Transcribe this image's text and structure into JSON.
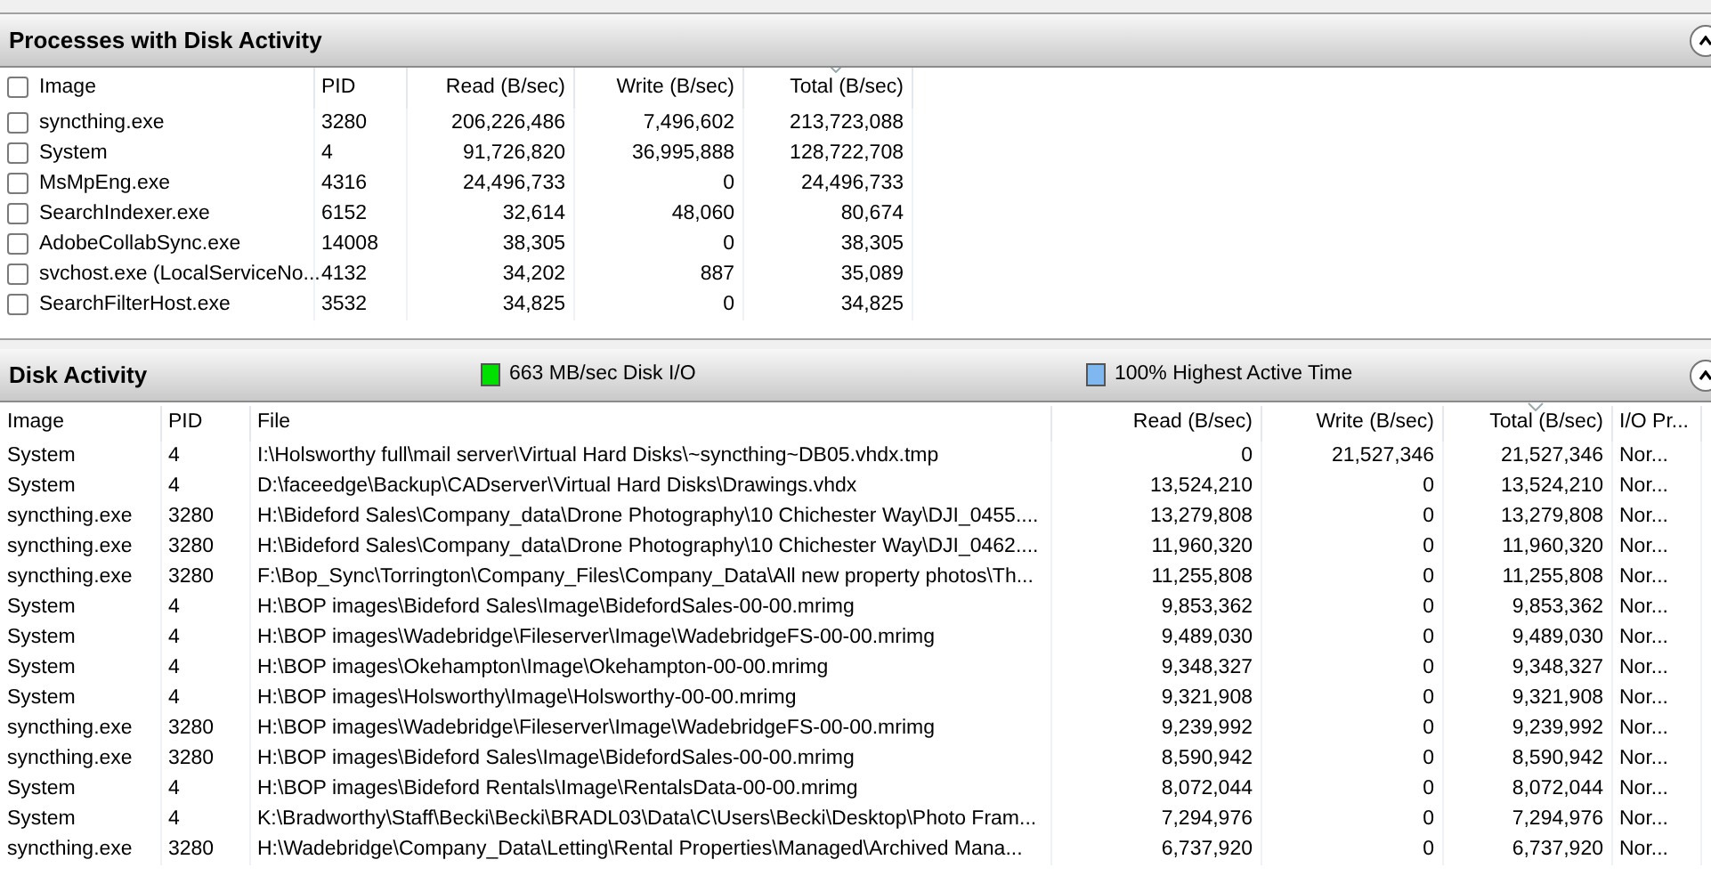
{
  "processes_panel": {
    "title": "Processes with Disk Activity",
    "expanded": true,
    "select_all": {
      "checked": false
    },
    "columns": [
      {
        "label": "Image",
        "sorted": false
      },
      {
        "label": "PID",
        "sorted": false
      },
      {
        "label": "Read (B/sec)",
        "sorted": false
      },
      {
        "label": "Write (B/sec)",
        "sorted": false
      },
      {
        "label": "Total (B/sec)",
        "sorted": true
      }
    ],
    "rows": [
      {
        "checked": false,
        "cells": [
          "syncthing.exe",
          "3280",
          "206,226,486",
          "7,496,602",
          "213,723,088"
        ]
      },
      {
        "checked": false,
        "cells": [
          "System",
          "4",
          "91,726,820",
          "36,995,888",
          "128,722,708"
        ]
      },
      {
        "checked": false,
        "cells": [
          "MsMpEng.exe",
          "4316",
          "24,496,733",
          "0",
          "24,496,733"
        ]
      },
      {
        "checked": false,
        "cells": [
          "SearchIndexer.exe",
          "6152",
          "32,614",
          "48,060",
          "80,674"
        ]
      },
      {
        "checked": false,
        "cells": [
          "AdobeCollabSync.exe",
          "14008",
          "38,305",
          "0",
          "38,305"
        ]
      },
      {
        "checked": false,
        "cells": [
          "svchost.exe (LocalServiceNo...",
          "4132",
          "34,202",
          "887",
          "35,089"
        ]
      },
      {
        "checked": false,
        "cells": [
          "SearchFilterHost.exe",
          "3532",
          "34,825",
          "0",
          "34,825"
        ]
      }
    ]
  },
  "disk_panel": {
    "title": "Disk Activity",
    "expanded": true,
    "legend": [
      {
        "label": "663 MB/sec Disk I/O",
        "color": "#00e000"
      },
      {
        "label": "100% Highest Active Time",
        "color": "#7fb8f0"
      }
    ],
    "columns": [
      {
        "label": "Image",
        "sorted": false
      },
      {
        "label": "PID",
        "sorted": false
      },
      {
        "label": "File",
        "sorted": false
      },
      {
        "label": "Read (B/sec)",
        "sorted": false
      },
      {
        "label": "Write (B/sec)",
        "sorted": false
      },
      {
        "label": "Total (B/sec)",
        "sorted": true
      },
      {
        "label": "I/O Pr...",
        "sorted": false
      }
    ],
    "rows": [
      [
        "System",
        "4",
        "I:\\Holsworthy full\\mail server\\Virtual Hard Disks\\~syncthing~DB05.vhdx.tmp",
        "0",
        "21,527,346",
        "21,527,346",
        "Nor..."
      ],
      [
        "System",
        "4",
        "D:\\faceedge\\Backup\\CADserver\\Virtual Hard Disks\\Drawings.vhdx",
        "13,524,210",
        "0",
        "13,524,210",
        "Nor..."
      ],
      [
        "syncthing.exe",
        "3280",
        "H:\\Bideford Sales\\Company_data\\Drone Photography\\10 Chichester Way\\DJI_0455....",
        "13,279,808",
        "0",
        "13,279,808",
        "Nor..."
      ],
      [
        "syncthing.exe",
        "3280",
        "H:\\Bideford Sales\\Company_data\\Drone Photography\\10 Chichester Way\\DJI_0462....",
        "11,960,320",
        "0",
        "11,960,320",
        "Nor..."
      ],
      [
        "syncthing.exe",
        "3280",
        "F:\\Bop_Sync\\Torrington\\Company_Files\\Company_Data\\All new property photos\\Th...",
        "11,255,808",
        "0",
        "11,255,808",
        "Nor..."
      ],
      [
        "System",
        "4",
        "H:\\BOP images\\Bideford Sales\\Image\\BidefordSales-00-00.mrimg",
        "9,853,362",
        "0",
        "9,853,362",
        "Nor..."
      ],
      [
        "System",
        "4",
        "H:\\BOP images\\Wadebridge\\Fileserver\\Image\\WadebridgeFS-00-00.mrimg",
        "9,489,030",
        "0",
        "9,489,030",
        "Nor..."
      ],
      [
        "System",
        "4",
        "H:\\BOP images\\Okehampton\\Image\\Okehampton-00-00.mrimg",
        "9,348,327",
        "0",
        "9,348,327",
        "Nor..."
      ],
      [
        "System",
        "4",
        "H:\\BOP images\\Holsworthy\\Image\\Holsworthy-00-00.mrimg",
        "9,321,908",
        "0",
        "9,321,908",
        "Nor..."
      ],
      [
        "syncthing.exe",
        "3280",
        "H:\\BOP images\\Wadebridge\\Fileserver\\Image\\WadebridgeFS-00-00.mrimg",
        "9,239,992",
        "0",
        "9,239,992",
        "Nor..."
      ],
      [
        "syncthing.exe",
        "3280",
        "H:\\BOP images\\Bideford Sales\\Image\\BidefordSales-00-00.mrimg",
        "8,590,942",
        "0",
        "8,590,942",
        "Nor..."
      ],
      [
        "System",
        "4",
        "H:\\BOP images\\Bideford Rentals\\Image\\RentalsData-00-00.mrimg",
        "8,072,044",
        "0",
        "8,072,044",
        "Nor..."
      ],
      [
        "System",
        "4",
        "K:\\Bradworthy\\Staff\\Becki\\Becki\\BRADL03\\Data\\C\\Users\\Becki\\Desktop\\Photo Fram...",
        "7,294,976",
        "0",
        "7,294,976",
        "Nor..."
      ],
      [
        "syncthing.exe",
        "3280",
        "H:\\Wadebridge\\Company_Data\\Letting\\Rental Properties\\Managed\\Archived Mana...",
        "6,737,920",
        "0",
        "6,737,920",
        "Nor..."
      ]
    ]
  }
}
